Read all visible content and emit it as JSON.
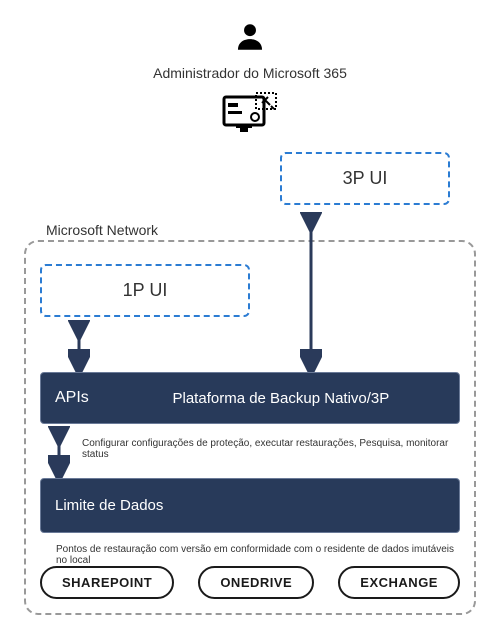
{
  "admin": {
    "title": "Administrador do Microsoft 365"
  },
  "ui": {
    "thirdParty": "3P UI",
    "firstParty": "1P UI"
  },
  "network": {
    "label": "Microsoft Network"
  },
  "apis": {
    "label": "APIs",
    "platform": "Plataforma de Backup Nativo/3P",
    "description": "Configurar configurações de proteção, executar restaurações, Pesquisa, monitorar status"
  },
  "dataLimit": {
    "label": "Limite de Dados",
    "description": "Pontos de restauração com versão em conformidade com o residente de dados imutáveis no local"
  },
  "services": {
    "sharepoint": "SHAREPOINT",
    "onedrive": "ONEDRIVE",
    "exchange": "EXCHANGE"
  }
}
